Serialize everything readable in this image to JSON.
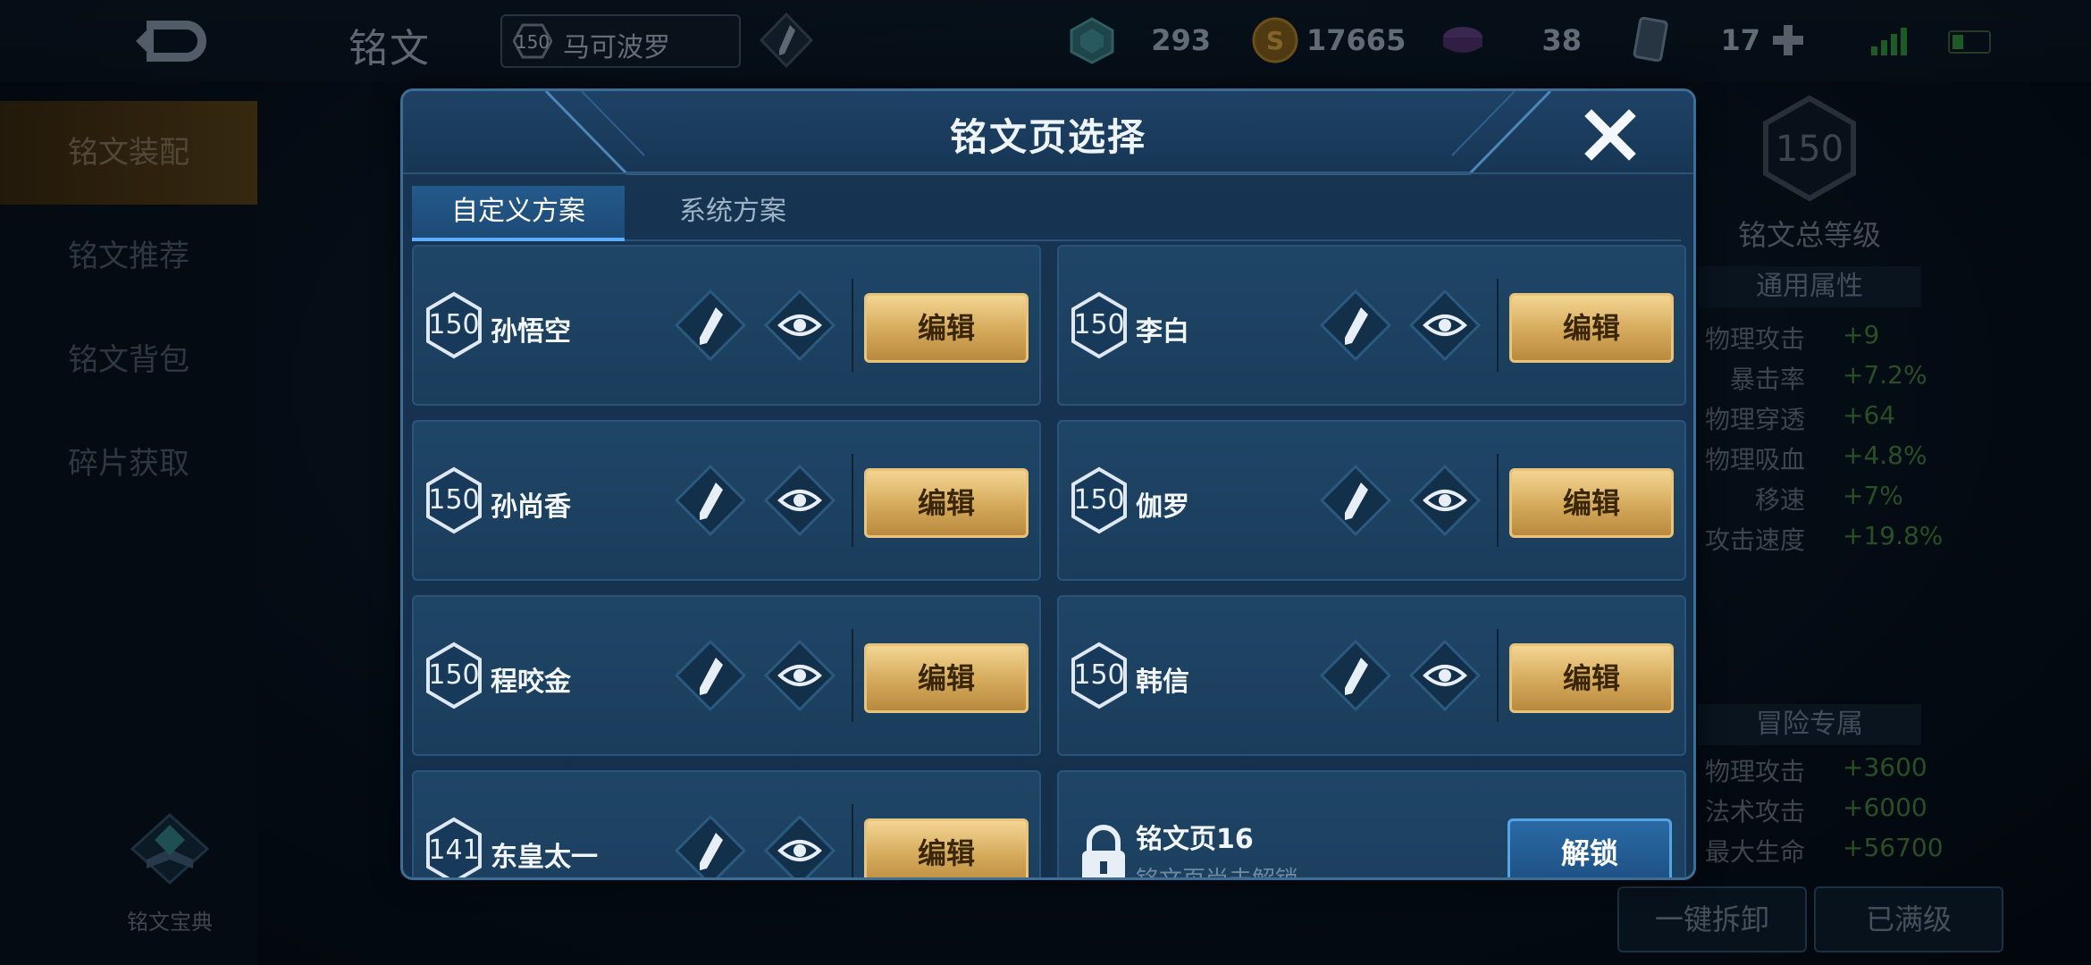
{
  "top": {
    "title": "铭文",
    "hero": {
      "level": "150",
      "name": "马可波罗"
    },
    "resources": [
      {
        "icon": "gem-icon",
        "value": "293"
      },
      {
        "icon": "gold-coin-icon",
        "value": "17665"
      },
      {
        "icon": "crystal-icon",
        "value": "38"
      },
      {
        "icon": "card-icon",
        "value": "17"
      }
    ]
  },
  "sidebar": {
    "items": [
      {
        "label": "铭文装配",
        "active": true
      },
      {
        "label": "铭文推荐",
        "active": false
      },
      {
        "label": "铭文背包",
        "active": false
      },
      {
        "label": "碎片获取",
        "active": false
      }
    ],
    "codex_label": "铭文宝典"
  },
  "right_panel": {
    "total_level": "150",
    "total_label": "铭文总等级",
    "general_title": "通用属性",
    "general_stats": [
      {
        "name": "物理攻击",
        "value": "+9"
      },
      {
        "name": "暴击率",
        "value": "+7.2%"
      },
      {
        "name": "物理穿透",
        "value": "+64"
      },
      {
        "name": "物理吸血",
        "value": "+4.8%"
      },
      {
        "name": "移速",
        "value": "+7%"
      },
      {
        "name": "攻击速度",
        "value": "+19.8%"
      }
    ],
    "adventure_title": "冒险专属",
    "adventure_stats": [
      {
        "name": "物理攻击",
        "value": "+3600"
      },
      {
        "name": "法术攻击",
        "value": "+6000"
      },
      {
        "name": "最大生命",
        "value": "+56700"
      }
    ],
    "btn_unload": "一键拆卸",
    "btn_maxed": "已满级"
  },
  "modal": {
    "title": "铭文页选择",
    "tabs": [
      "自定义方案",
      "系统方案"
    ],
    "edit_label": "编辑",
    "pages": [
      {
        "level": "150",
        "name": "孙悟空"
      },
      {
        "level": "150",
        "name": "李白"
      },
      {
        "level": "150",
        "name": "孙尚香"
      },
      {
        "level": "150",
        "name": "伽罗"
      },
      {
        "level": "150",
        "name": "程咬金"
      },
      {
        "level": "150",
        "name": "韩信"
      },
      {
        "level": "141",
        "name": "东皇太一"
      }
    ],
    "locked_page": {
      "title": "铭文页16",
      "subtitle": "铭文页尚未解锁",
      "button": "解锁"
    }
  },
  "colors": {
    "accent_gold": "#d4a95a",
    "accent_blue": "#55a4e6",
    "stat_green": "#3f7a3c"
  }
}
